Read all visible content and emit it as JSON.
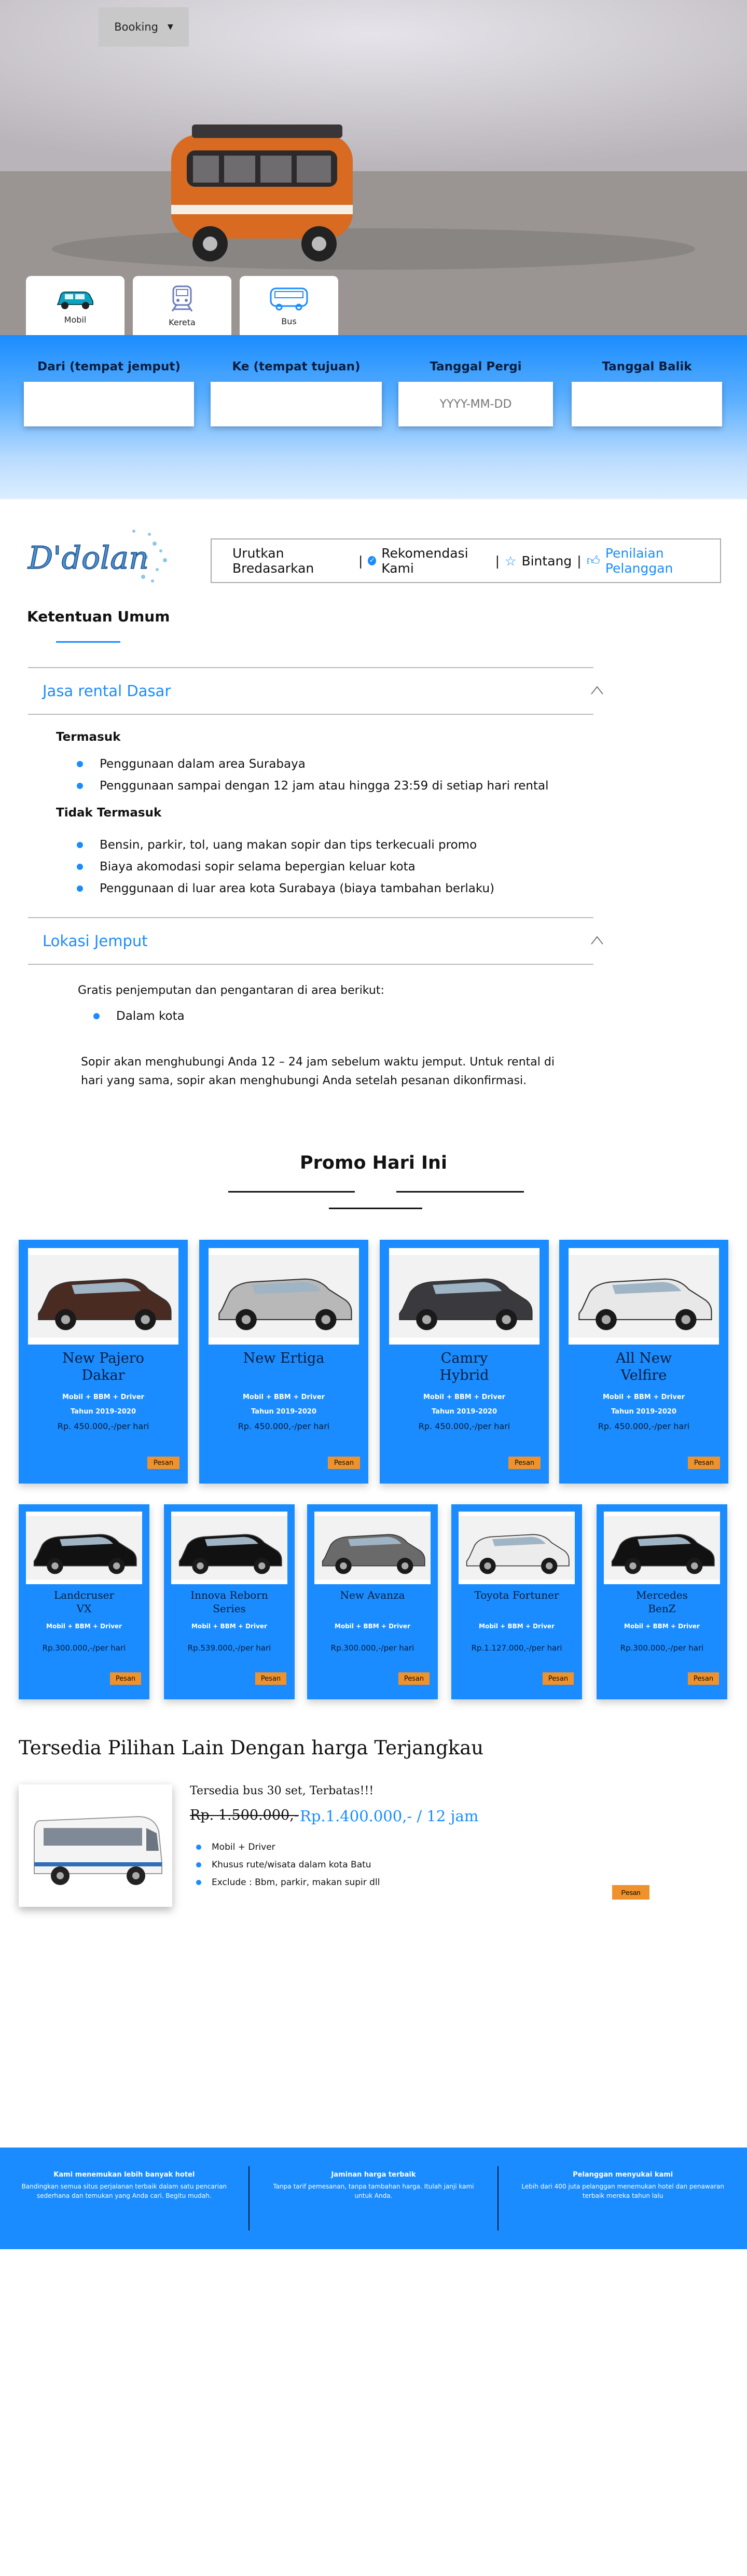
{
  "nav": {
    "booking_label": "Booking"
  },
  "transport_tabs": [
    {
      "label": "Mobil",
      "icon": "car-icon"
    },
    {
      "label": "Kereta",
      "icon": "train-icon"
    },
    {
      "label": "Bus",
      "icon": "bus-icon"
    }
  ],
  "search": {
    "from_label": "Dari (tempat jemput)",
    "to_label": "Ke (tempat tujuan)",
    "depart_label": "Tanggal Pergi",
    "depart_placeholder": "YYYY-MM-DD",
    "return_label": "Tanggal Balik"
  },
  "brand": {
    "logo_text": "D'dolan"
  },
  "sort": {
    "prefix": "Urutkan Bredasarkan",
    "option1": "Rekomendasi Kami",
    "option2": "Bintang",
    "option3": "Penilaian Pelanggan"
  },
  "ketentuan": {
    "title": "Ketentuan Umum",
    "section1": {
      "title": "Jasa rental Dasar",
      "termasuk_label": "Termasuk",
      "termasuk": [
        "Penggunaan dalam area Surabaya",
        "Penggunaan sampai dengan 12 jam atau hingga 23:59 di setiap hari rental"
      ],
      "tidak_label": "Tidak Termasuk",
      "tidak": [
        "Bensin, parkir, tol, uang makan sopir dan tips terkecuali promo",
        "Biaya akomodasi sopir selama bepergian keluar kota",
        "Penggunaan di luar area kota Surabaya (biaya tambahan berlaku)"
      ]
    },
    "section2": {
      "title": "Lokasi Jemput",
      "intro": "Gratis penjemputan dan pengantaran di area berikut:",
      "items": [
        "Dalam kota"
      ],
      "note_line1": "Sopir akan menghubungi Anda 12 – 24 jam sebelum waktu jemput. Untuk rental di",
      "note_line2": "hari yang sama, sopir akan menghubungi Anda setelah pesanan dikonfirmasi."
    }
  },
  "promo": {
    "title": "Promo Hari Ini",
    "row1": [
      {
        "name1": "New Pajero",
        "name2": "Dakar",
        "feat": "Mobil + BBM + Driver",
        "year": "Tahun 2019-2020",
        "price": "Rp. 450.000,-/per hari",
        "btn": "Pesan"
      },
      {
        "name1": "New Ertiga",
        "name2": "",
        "feat": "Mobil + BBM + Driver",
        "year": "Tahun 2019-2020",
        "price": "Rp. 450.000,-/per hari",
        "btn": "Pesan"
      },
      {
        "name1": "Camry",
        "name2": "Hybrid",
        "feat": "Mobil + BBM + Driver",
        "year": "Tahun 2019-2020",
        "price": "Rp. 450.000,-/per hari",
        "btn": "Pesan"
      },
      {
        "name1": "All New",
        "name2": "Velfire",
        "feat": "Mobil + BBM + Driver",
        "year": "Tahun 2019-2020",
        "price": "Rp. 450.000,-/per hari",
        "btn": "Pesan"
      }
    ],
    "row2": [
      {
        "name1": "Landcruser",
        "name2": "VX",
        "feat": "Mobil + BBM +  Driver",
        "price": "Rp.300.000,-/per hari",
        "btn": "Pesan"
      },
      {
        "name1": "Innova Reborn",
        "name2": "Series",
        "feat": "Mobil + BBM +  Driver",
        "price": "Rp.539.000,-/per hari",
        "btn": "Pesan"
      },
      {
        "name1": "New Avanza",
        "name2": "",
        "feat": "Mobil + BBM +  Driver",
        "price": "Rp.300.000,-/per hari",
        "btn": "Pesan"
      },
      {
        "name1": "Toyota Fortuner",
        "name2": "",
        "feat": "Mobil + BBM + Driver",
        "price": "Rp.1.127.000,-/per hari",
        "btn": "Pesan"
      },
      {
        "name1": "Mercedes",
        "name2": "BenZ",
        "feat": "Mobil + BBM + Driver",
        "price": "Rp.300.000,-/per hari",
        "btn": "Pesan"
      }
    ]
  },
  "alternatives": {
    "title": "Tersedia Pilihan Lain Dengan harga Terjangkau",
    "subtitle": "Tersedia bus 30 set, Terbatas!!!",
    "old_price": "Rp. 1.500.000,-",
    "new_price": "Rp.1.400.000,- / 12 jam",
    "bullets": [
      "Mobil + Driver",
      "Khusus rute/wisata dalam kota Batu",
      "Exclude : Bbm, parkir, makan supir dll"
    ],
    "btn": "Pesan"
  },
  "footer": {
    "col1_title": "Kami menemukan lebih banyak hotel",
    "col1_text": "Bandingkan semua situs perjalanan terbaik dalam satu pencarian sederhana dan temukan yang Anda cari. Begitu mudah.",
    "col2_title": "Jaminan harga terbaik",
    "col2_text": "Tanpa tarif pemesanan, tanpa tambahan harga. Itulah janji kami untuk Anda.",
    "col3_title": "Pelanggan menyukai kami",
    "col3_text": "Lebih dari 400 juta pelanggan menemukan hotel dan penawaran terbaik mereka tahun lalu"
  },
  "colors": {
    "accent": "#1a8cff",
    "button": "#f0922b",
    "navy": "#0b1d3a"
  }
}
